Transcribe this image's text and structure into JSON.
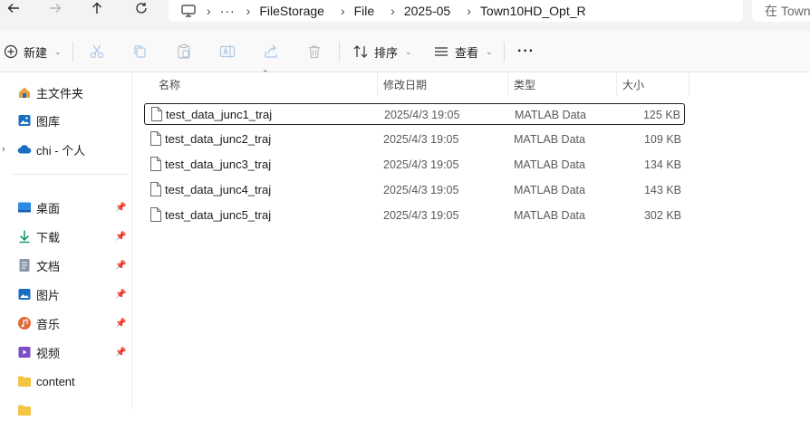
{
  "toolbar": {
    "new_label": "新建",
    "sort_label": "排序",
    "view_label": "查看",
    "more_label": "···"
  },
  "breadcrumb": [
    "FileStorage",
    "File",
    "2025-05",
    "Town10HD_Opt_R"
  ],
  "search": {
    "placeholder": "在 Town"
  },
  "sidebar": {
    "home": "主文件夹",
    "gallery": "图库",
    "onedrive": "chi - 个人",
    "pinned": [
      {
        "label": "桌面",
        "icon": "desktop-icon"
      },
      {
        "label": "下载",
        "icon": "download-icon"
      },
      {
        "label": "文档",
        "icon": "document-icon"
      },
      {
        "label": "图片",
        "icon": "pictures-icon"
      },
      {
        "label": "音乐",
        "icon": "music-icon"
      },
      {
        "label": "视频",
        "icon": "video-icon"
      }
    ],
    "folders": [
      {
        "label": "content"
      }
    ]
  },
  "columns": {
    "name": "名称",
    "date": "修改日期",
    "type": "类型",
    "size": "大小"
  },
  "files": [
    {
      "name": "test_data_junc1_traj",
      "date": "2025/4/3 19:05",
      "type": "MATLAB Data",
      "size": "125 KB"
    },
    {
      "name": "test_data_junc2_traj",
      "date": "2025/4/3 19:05",
      "type": "MATLAB Data",
      "size": "109 KB"
    },
    {
      "name": "test_data_junc3_traj",
      "date": "2025/4/3 19:05",
      "type": "MATLAB Data",
      "size": "134 KB"
    },
    {
      "name": "test_data_junc4_traj",
      "date": "2025/4/3 19:05",
      "type": "MATLAB Data",
      "size": "143 KB"
    },
    {
      "name": "test_data_junc5_traj",
      "date": "2025/4/3 19:05",
      "type": "MATLAB Data",
      "size": "302 KB"
    }
  ],
  "colors": {
    "accent": "#0067c0",
    "folder": "#f4c542"
  }
}
